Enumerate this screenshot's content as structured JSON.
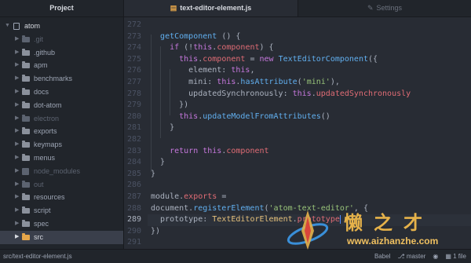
{
  "sidebar": {
    "title": "Project",
    "root": "atom",
    "items": [
      {
        "label": ".git",
        "dim": true
      },
      {
        "label": ".github",
        "dim": false
      },
      {
        "label": "apm",
        "dim": false
      },
      {
        "label": "benchmarks",
        "dim": false
      },
      {
        "label": "docs",
        "dim": false
      },
      {
        "label": "dot-atom",
        "dim": false
      },
      {
        "label": "electron",
        "dim": true
      },
      {
        "label": "exports",
        "dim": false
      },
      {
        "label": "keymaps",
        "dim": false
      },
      {
        "label": "menus",
        "dim": false
      },
      {
        "label": "node_modules",
        "dim": true
      },
      {
        "label": "out",
        "dim": true
      },
      {
        "label": "resources",
        "dim": false
      },
      {
        "label": "script",
        "dim": false
      },
      {
        "label": "spec",
        "dim": false
      },
      {
        "label": "src",
        "dim": false
      }
    ]
  },
  "tabs": {
    "active": "text-editor-element.js",
    "settings": "Settings"
  },
  "editor": {
    "current_line": "289",
    "lines": [
      {
        "n": "272",
        "code": ""
      },
      {
        "n": "273",
        "code": "  getComponent () {"
      },
      {
        "n": "274",
        "code": "    if (!this.component) {"
      },
      {
        "n": "275",
        "code": "      this.component = new TextEditorComponent({"
      },
      {
        "n": "276",
        "code": "        element: this,"
      },
      {
        "n": "277",
        "code": "        mini: this.hasAttribute('mini'),"
      },
      {
        "n": "278",
        "code": "        updatedSynchronously: this.updatedSynchronously"
      },
      {
        "n": "279",
        "code": "      })"
      },
      {
        "n": "280",
        "code": "      this.updateModelFromAttributes()"
      },
      {
        "n": "281",
        "code": "    }"
      },
      {
        "n": "282",
        "code": ""
      },
      {
        "n": "283",
        "code": "    return this.component"
      },
      {
        "n": "284",
        "code": "  }"
      },
      {
        "n": "285",
        "code": "}"
      },
      {
        "n": "286",
        "code": ""
      },
      {
        "n": "287",
        "code": "module.exports ="
      },
      {
        "n": "288",
        "code": "document.registerElement('atom-text-editor', {"
      },
      {
        "n": "289",
        "code": "  prototype: TextEditorElement.prototype"
      },
      {
        "n": "290",
        "code": "})"
      },
      {
        "n": "291",
        "code": ""
      }
    ]
  },
  "status": {
    "path": "src/text-editor-element.js",
    "grammar": "Babel",
    "branch": "master",
    "files": "1 file"
  },
  "watermark": {
    "text": "懒之才",
    "url": "www.aizhanzhe.com"
  },
  "colors": {
    "keyword": "#c678dd",
    "function": "#61afef",
    "variable": "#e06c75",
    "string": "#98c379",
    "class": "#e5c07b",
    "folder_selected": "#e5a64a"
  }
}
